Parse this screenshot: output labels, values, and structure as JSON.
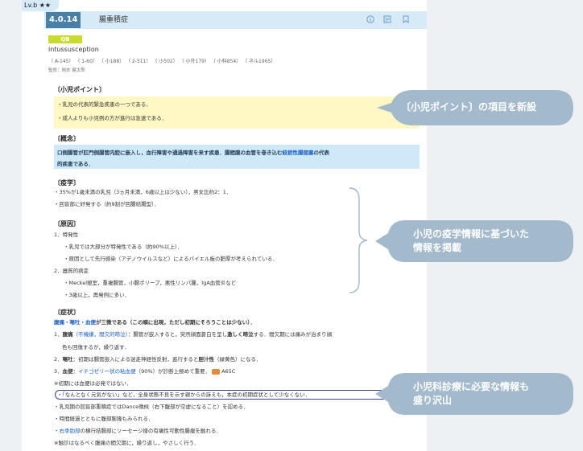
{
  "level_tab": "Lv.b ★★",
  "topic": {
    "number": "4.0.14",
    "title": "腸重積症",
    "icons": [
      "info-icon",
      "memo-icon",
      "bookmark-icon"
    ]
  },
  "badge": "QB",
  "english_term": "intussusception",
  "references": "（ A-145） （ 1-60） （ 小188） （ 2-511） （ 小502） （ 小外179） （ 小科854） （ ネル1965）",
  "supervisor": "監修：岡本 健太郎",
  "pediatric_point": {
    "heading": "〔小児ポイント〕",
    "lines": [
      "・乳児の代表的緊急疾患の一つである．",
      "・成人よりも小児例の方が進行は急速である．"
    ]
  },
  "concept": {
    "heading": "〔概念〕",
    "line1_a": "口側腸管が肛門側腸管内腔に嵌入し，血行障害や通過障害を来す疾患．腸間膜の血管を巻き込む",
    "line1_b": "絞扼性腸閉塞",
    "line1_c": "の代表",
    "line2": "的疾患である．"
  },
  "epidemiology": {
    "heading": "〔疫学〕",
    "lines": [
      "・35%が1歳未満の乳児（3ヵ月未満，6歳以上は少ない），男女比約2：1．",
      "・回盲部に好発する（約9割が回腸結腸型）．"
    ]
  },
  "cause": {
    "heading": "〔原因〕",
    "lines": [
      "1．特発性",
      "・乳児では大部分が特発性である（約90%以上）．",
      "・原因として先行感染（アデノウイルスなど）によるパイエル板の肥厚が考えられている．",
      "2．器質的病変",
      "・Meckel憩室，重複腸管，小腸ポリープ，悪性リンパ腫，IgA血管炎など",
      "・3歳以上，再発例に多い．"
    ]
  },
  "symptoms": {
    "heading": "〔症状〕",
    "triad_a": "腹痛・嘔吐・血便",
    "triad_b": "が三徴である（この順に出現，ただし初期にそろうことは少ない）．",
    "pain_num": "1．",
    "pain_label": "腹痛",
    "pain_detail_a": "（不機嫌，間欠的啼泣）",
    "pain_detail_b": "：腸管が嵌入すると，突然顔面蒼白を呈し",
    "pain_detail_c": "激しく啼泣",
    "pain_detail_d": "する．間欠期には痛みが治まり顔",
    "pain_cont": "色も回復するが，繰り返す．",
    "vomit_num": "2．",
    "vomit_label": "嘔吐",
    "vomit_detail_a": "：初期は腸管嵌入による迷走神経性反射，進行すると",
    "vomit_detail_b": "胆汁性",
    "vomit_detail_c": "（緑黄色）になる．",
    "blood_num": "3．",
    "blood_label": "血便",
    "blood_detail_a": "：",
    "blood_detail_b": "イチゴゼリー状の粘血便",
    "blood_detail_c": "（90%）が診断上極めて重要．",
    "blood_ref": "A65C",
    "note1": "※初期には血便は必発ではない．",
    "circled": "・「なんとなく元気がない」など，全身状態不良を示す親からの訴えも，本症の初期症状として少なくない．",
    "line_a": "・乳児期の回盲部重積症ではDance徴候（右下腹部が空虚になること）を認める．",
    "line_b": "・時間経過とともに腹部膨隆もみられる．",
    "line_c_a": "・",
    "line_c_b": "右季肋部",
    "line_c_c": "の横行結腸部にソーセージ様の有痛性可動性腫瘤を触れる．",
    "note2": "※触診はなるべく腹痛の間欠期に，繰り返し，やさしく行う．"
  },
  "callouts": [
    {
      "lines": [
        "〔小児ポイント〕の項目を新設"
      ]
    },
    {
      "lines": [
        "小児の疫学情報に基づいた",
        "情報を掲載"
      ]
    },
    {
      "lines": [
        "小児科診療に必要な情報も",
        "盛り沢山"
      ]
    }
  ],
  "colors": {
    "callout_bg": "#a3b9cc",
    "title_bar": "#d6ebf7",
    "point_bg": "#fff7c4",
    "concept_bg": "#cfe9f8",
    "accent_blue": "#1a5fc8",
    "badge": "#c9dc2d"
  }
}
